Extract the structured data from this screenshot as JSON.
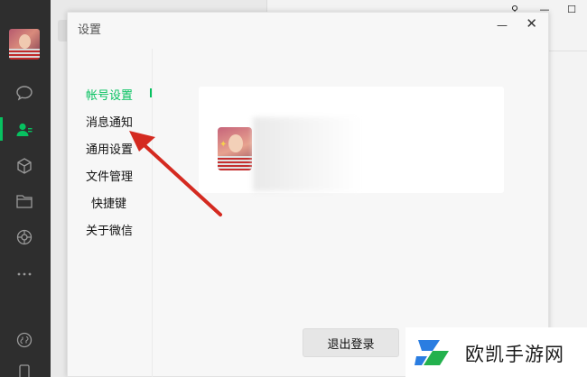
{
  "colors": {
    "accent": "#07c160",
    "sidebar_bg": "#2e2e2e",
    "arrow": "#d42a20"
  },
  "sidebar": {
    "icons": [
      "chat-icon",
      "contacts-icon",
      "favorites-cube-icon",
      "folder-icon",
      "moments-icon",
      "more-icon",
      "mini-program-icon",
      "phone-icon"
    ]
  },
  "window_controls": {
    "pin": "⚲",
    "minimize": "—",
    "maximize": "☐"
  },
  "dialog": {
    "title": "设置",
    "minimize": "—",
    "close": "✕"
  },
  "nav": {
    "items": [
      {
        "label": "帐号设置",
        "active": true
      },
      {
        "label": "消息通知",
        "active": false
      },
      {
        "label": "通用设置",
        "active": false
      },
      {
        "label": "文件管理",
        "active": false
      },
      {
        "label": "快捷键",
        "active": false
      },
      {
        "label": "关于微信",
        "active": false
      }
    ]
  },
  "account": {
    "logout_label": "退出登录"
  },
  "watermark": {
    "text": "欧凯手游网"
  }
}
